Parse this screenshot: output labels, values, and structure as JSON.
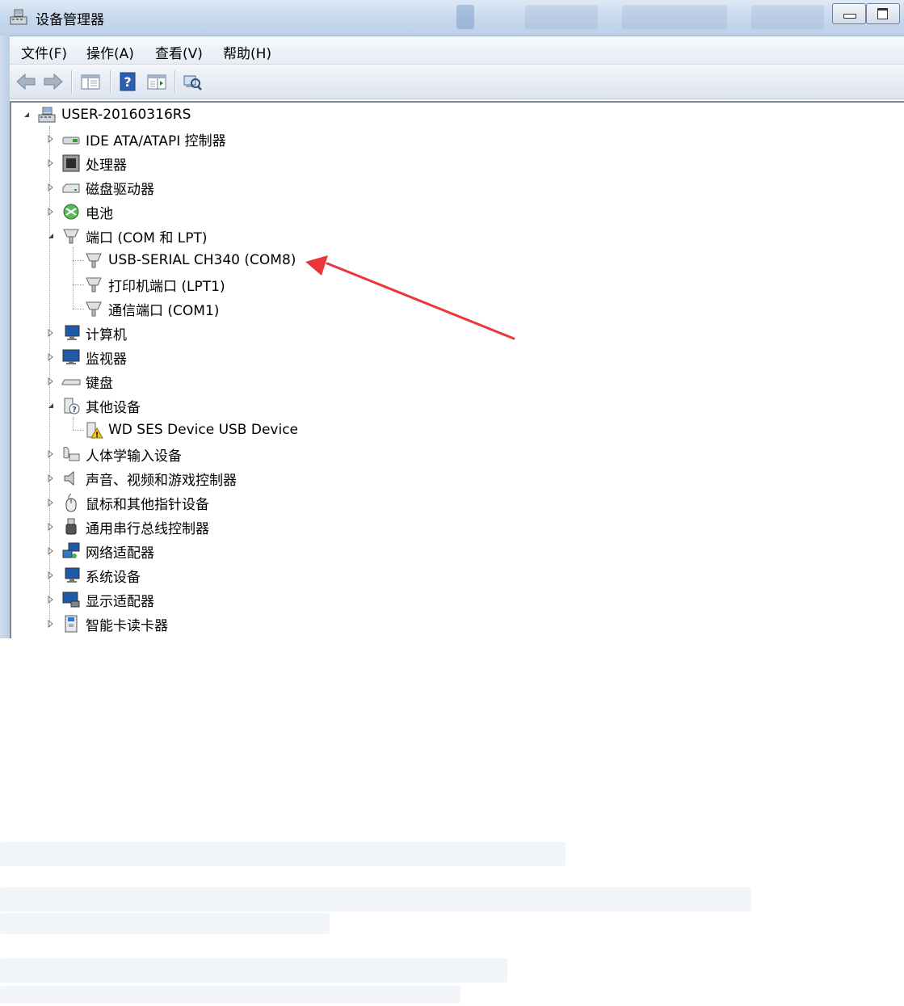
{
  "window": {
    "title": "设备管理器"
  },
  "menu": [
    "文件(F)",
    "操作(A)",
    "查看(V)",
    "帮助(H)"
  ],
  "toolbar": [
    "back-icon",
    "forward-icon",
    "console-tree-icon",
    "help-icon",
    "properties-icon",
    "scan-hardware-icon"
  ],
  "tree": {
    "root": "USER-20160316RS",
    "categories": [
      {
        "label": "IDE ATA/ATAPI 控制器",
        "icon": "ide-controller-icon",
        "expanded": false
      },
      {
        "label": "处理器",
        "icon": "processor-icon",
        "expanded": false
      },
      {
        "label": "磁盘驱动器",
        "icon": "disk-drive-icon",
        "expanded": false
      },
      {
        "label": "电池",
        "icon": "battery-icon",
        "expanded": false
      },
      {
        "label": "端口 (COM 和 LPT)",
        "icon": "port-icon",
        "expanded": true,
        "children": [
          "USB-SERIAL CH340 (COM8)",
          "打印机端口 (LPT1)",
          "通信端口 (COM1)"
        ]
      },
      {
        "label": "计算机",
        "icon": "computer-icon",
        "expanded": false
      },
      {
        "label": "监视器",
        "icon": "monitor-icon",
        "expanded": false
      },
      {
        "label": "键盘",
        "icon": "keyboard-icon",
        "expanded": false
      },
      {
        "label": "其他设备",
        "icon": "other-devices-icon",
        "expanded": true,
        "children": [
          "WD SES Device USB Device"
        ]
      },
      {
        "label": "人体学输入设备",
        "icon": "hid-icon",
        "expanded": false
      },
      {
        "label": "声音、视频和游戏控制器",
        "icon": "sound-icon",
        "expanded": false
      },
      {
        "label": "鼠标和其他指针设备",
        "icon": "mouse-icon",
        "expanded": false
      },
      {
        "label": "通用串行总线控制器",
        "icon": "usb-icon",
        "expanded": false
      },
      {
        "label": "网络适配器",
        "icon": "network-icon",
        "expanded": false
      },
      {
        "label": "系统设备",
        "icon": "system-icon",
        "expanded": false
      },
      {
        "label": "显示适配器",
        "icon": "display-icon",
        "expanded": false
      },
      {
        "label": "智能卡读卡器",
        "icon": "smartcard-icon",
        "expanded": false
      }
    ]
  },
  "annotation": {
    "arrow_color": "#e8363a"
  }
}
